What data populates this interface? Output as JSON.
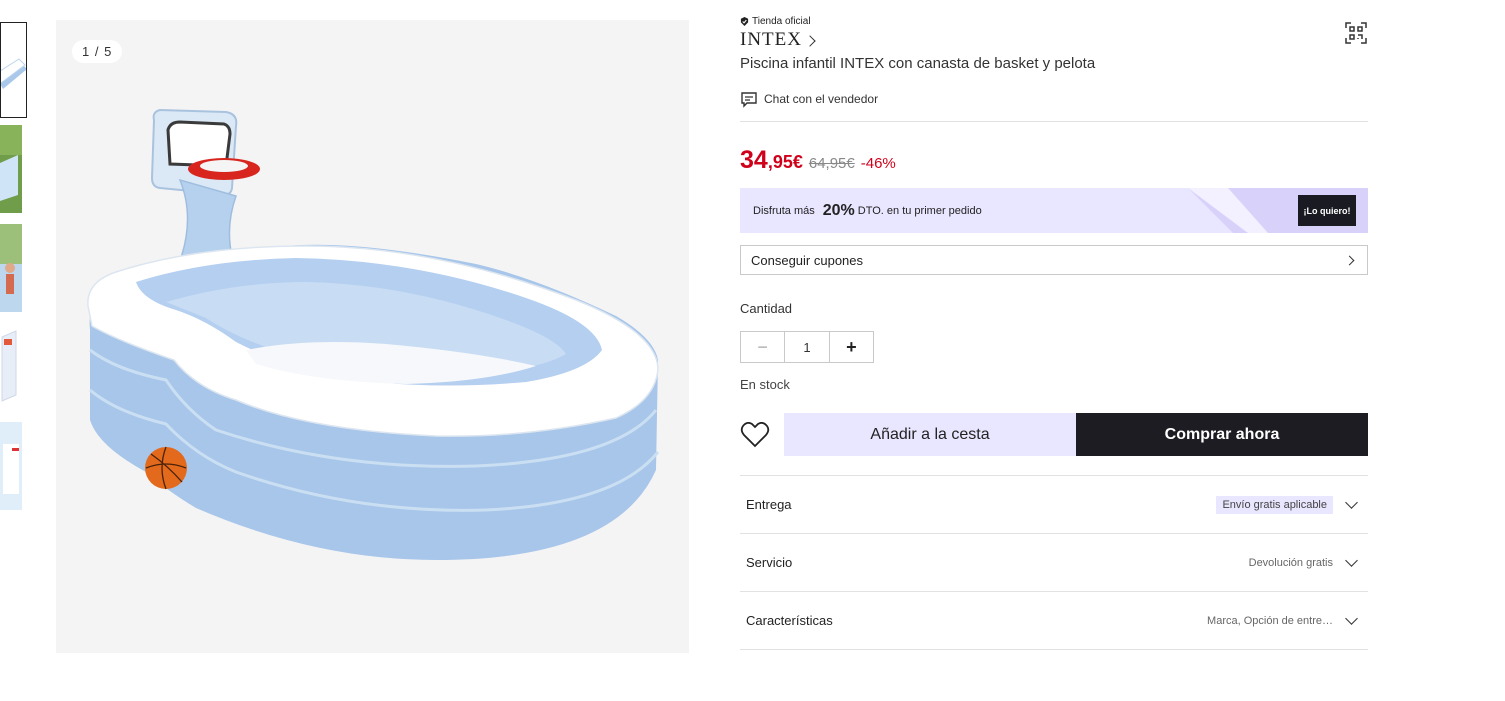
{
  "gallery": {
    "counter": "1 / 5",
    "thumbnails": [
      {
        "icon": "pool-thumbnail",
        "active": true
      },
      {
        "icon": "pool-outdoor-thumbnail"
      },
      {
        "icon": "kids-pool-thumbnail"
      },
      {
        "icon": "box-thumbnail"
      },
      {
        "icon": "info-thumbnail"
      }
    ]
  },
  "product": {
    "store_tag": "Tienda oficial",
    "brand": "INTEX",
    "title": "Piscina infantil INTEX con canasta de basket y pelota",
    "chat_label": "Chat con el vendedor"
  },
  "pricing": {
    "integer": "34",
    "decimals": ",95€",
    "old_price": "64,95€",
    "discount": "-46%",
    "price_color": "#d0021b"
  },
  "promo": {
    "text_before": "Disfruta más",
    "percent": "20%",
    "text_after": "DTO. en tu primer pedido",
    "button": "¡Lo quiero!"
  },
  "coupons": {
    "label": "Conseguir cupones"
  },
  "quantity": {
    "label": "Cantidad",
    "minus": "−",
    "value": "1",
    "plus": "+",
    "stock": "En stock"
  },
  "actions": {
    "add_to_cart": "Añadir a la cesta",
    "buy_now": "Comprar ahora"
  },
  "details": [
    {
      "title": "Entrega",
      "value": "Envío gratis aplicable",
      "badge": true
    },
    {
      "title": "Servicio",
      "value": "Devolución gratis",
      "badge": false
    },
    {
      "title": "Características",
      "value": "Marca, Opción de entre…",
      "badge": false
    }
  ]
}
